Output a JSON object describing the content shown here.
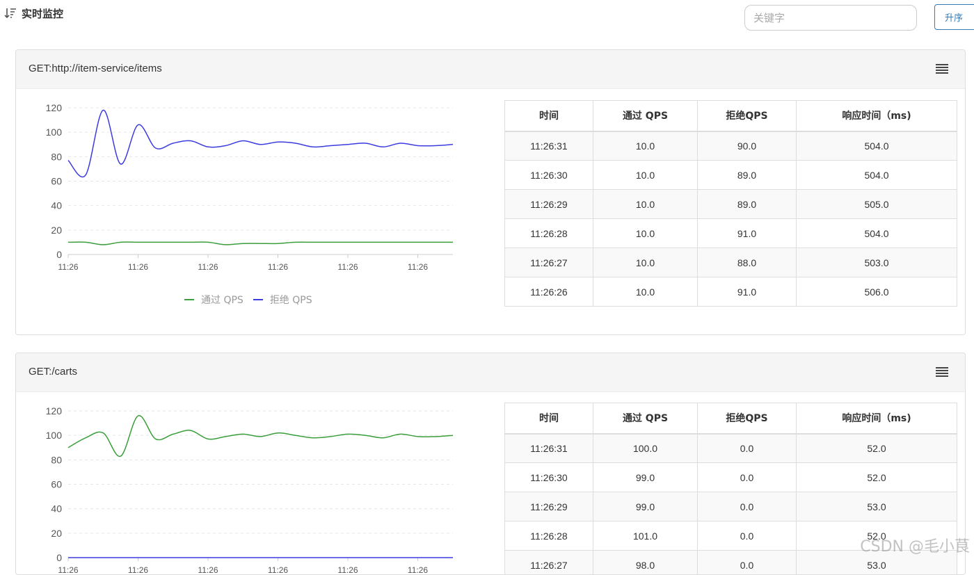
{
  "header": {
    "title": "实时监控",
    "search_placeholder": "关键字",
    "sort_label": "升序"
  },
  "legend": {
    "pass": "通过 QPS",
    "block": "拒绝 QPS"
  },
  "colors": {
    "pass": "#3a9e3a",
    "block": "#3b3be0",
    "accent": "#337ab7"
  },
  "table_headers": [
    "时间",
    "通过 QPS",
    "拒绝QPS",
    "响应时间（ms)"
  ],
  "panels": [
    {
      "title": "GET:http://item-service/items",
      "rows": [
        [
          "11:26:31",
          "10.0",
          "90.0",
          "504.0"
        ],
        [
          "11:26:30",
          "10.0",
          "89.0",
          "504.0"
        ],
        [
          "11:26:29",
          "10.0",
          "89.0",
          "505.0"
        ],
        [
          "11:26:28",
          "10.0",
          "91.0",
          "504.0"
        ],
        [
          "11:26:27",
          "10.0",
          "88.0",
          "503.0"
        ],
        [
          "11:26:26",
          "10.0",
          "91.0",
          "506.0"
        ]
      ]
    },
    {
      "title": "GET:/carts",
      "rows": [
        [
          "11:26:31",
          "100.0",
          "0.0",
          "52.0"
        ],
        [
          "11:26:30",
          "99.0",
          "0.0",
          "52.0"
        ],
        [
          "11:26:29",
          "99.0",
          "0.0",
          "53.0"
        ],
        [
          "11:26:28",
          "101.0",
          "0.0",
          "52.0"
        ],
        [
          "11:26:27",
          "98.0",
          "0.0",
          "53.0"
        ]
      ]
    }
  ],
  "chart_data": [
    {
      "type": "line",
      "ylim": [
        0,
        120
      ],
      "yticks": [
        0,
        20,
        40,
        60,
        80,
        100,
        120
      ],
      "xticks": [
        "11:26",
        "11:26",
        "11:26",
        "11:26",
        "11:26",
        "11:26"
      ],
      "series": [
        {
          "name": "通过 QPS",
          "color": "#3a9e3a",
          "values": [
            10,
            10,
            8,
            10,
            10,
            10,
            10,
            10,
            10,
            8,
            9,
            9,
            9,
            10,
            10,
            10,
            10,
            10,
            10,
            10,
            10,
            10,
            10
          ]
        },
        {
          "name": "拒绝 QPS",
          "color": "#3b3be0",
          "values": [
            77,
            65,
            118,
            74,
            106,
            87,
            91,
            93,
            88,
            89,
            93,
            90,
            92,
            91,
            88,
            89,
            90,
            91,
            88,
            91,
            89,
            89,
            90
          ]
        }
      ]
    },
    {
      "type": "line",
      "ylim": [
        0,
        120
      ],
      "yticks": [
        0,
        20,
        40,
        60,
        80,
        100,
        120
      ],
      "xticks": [
        "11:26",
        "11:26",
        "11:26",
        "11:26",
        "11:26",
        "11:26"
      ],
      "series": [
        {
          "name": "通过 QPS",
          "color": "#3a9e3a",
          "values": [
            90,
            98,
            102,
            83,
            116,
            97,
            101,
            104,
            97,
            99,
            101,
            99,
            102,
            100,
            98,
            99,
            101,
            100,
            98,
            101,
            99,
            99,
            100
          ]
        },
        {
          "name": "拒绝 QPS",
          "color": "#3b3be0",
          "values": [
            0,
            0,
            0,
            0,
            0,
            0,
            0,
            0,
            0,
            0,
            0,
            0,
            0,
            0,
            0,
            0,
            0,
            0,
            0,
            0,
            0,
            0,
            0
          ]
        }
      ]
    }
  ],
  "watermark": "CSDN @毛小茛"
}
